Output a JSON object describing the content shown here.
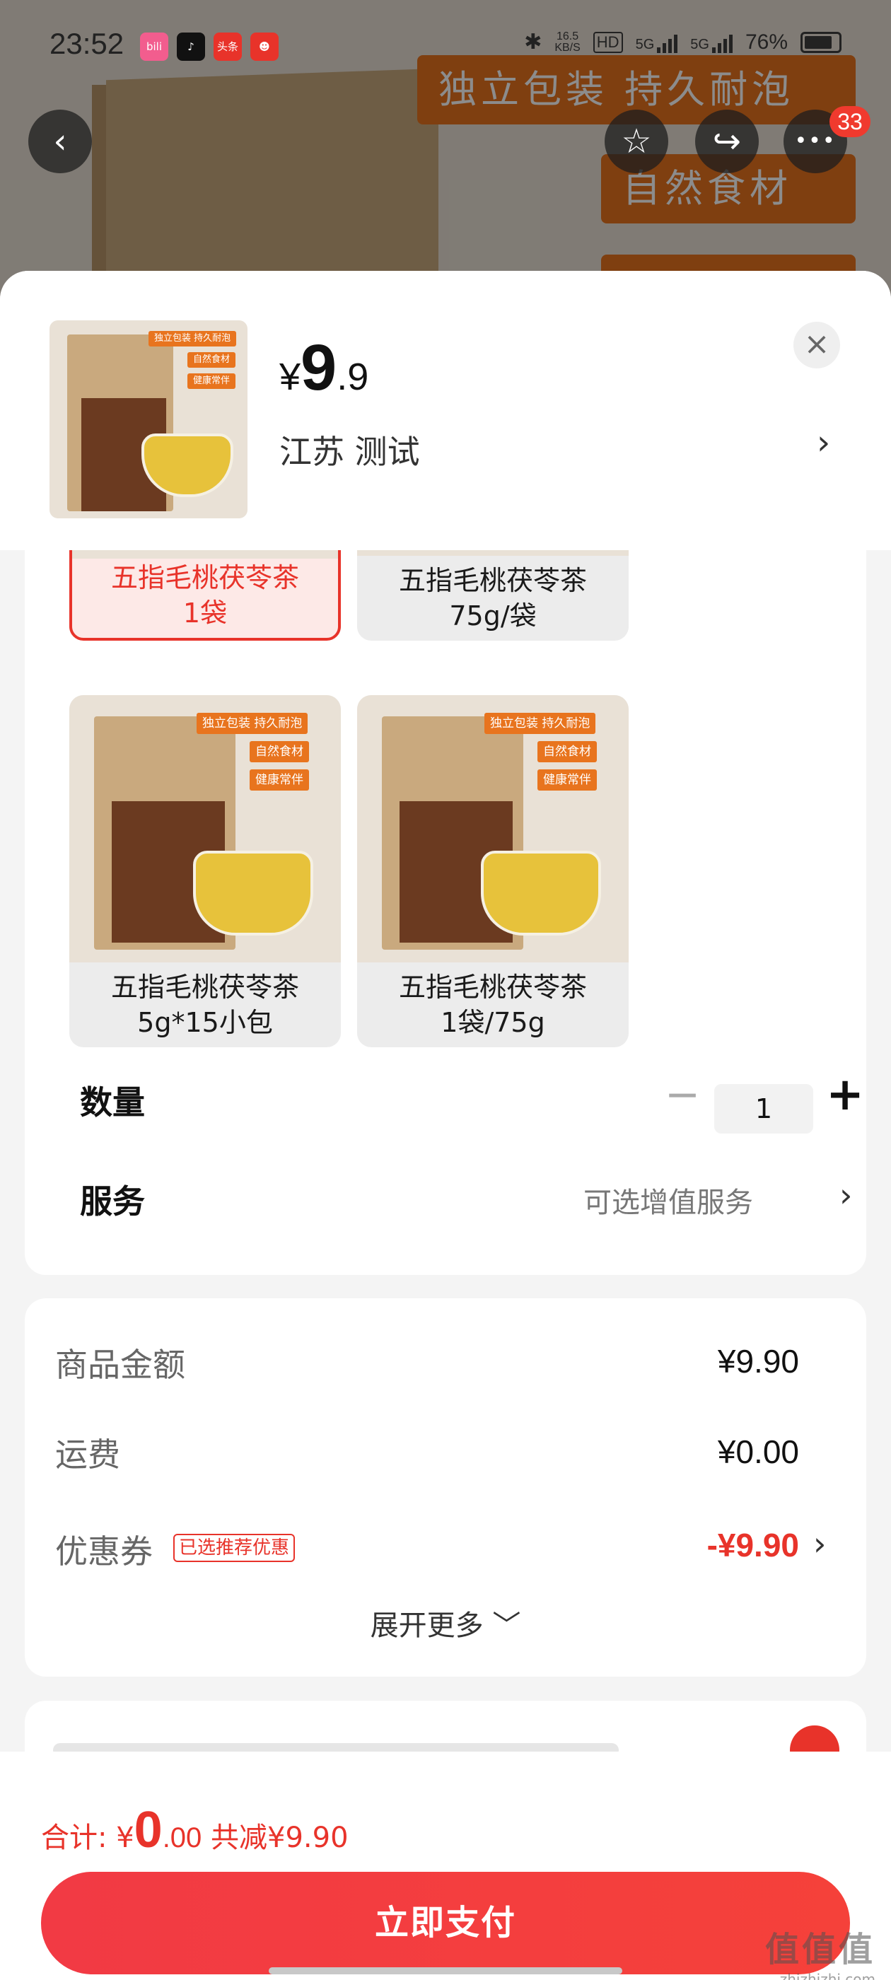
{
  "status_bar": {
    "time": "23:52",
    "app_icons": [
      {
        "name": "bilibili-icon",
        "text": "bili",
        "color": "#f25d8e"
      },
      {
        "name": "douyin-icon",
        "text": "♪",
        "color": "#111111"
      },
      {
        "name": "toutiao-icon",
        "text": "头条",
        "color": "#e8332a"
      },
      {
        "name": "notify-app-icon",
        "text": "☻",
        "color": "#e8332a"
      }
    ],
    "net_speed": "16.5",
    "net_unit": "KB/S",
    "hd": "HD",
    "signal1": "5G",
    "signal2": "5G",
    "battery": "76%"
  },
  "background": {
    "tag1": "独立包装 持久耐泡",
    "tag2": "自然食材"
  },
  "nav": {
    "back_icon": "‹",
    "favorite_icon": "☆",
    "share_icon": "↪",
    "more_icon": "•••",
    "badge_count": "33"
  },
  "sheet": {
    "price": {
      "currency": "¥",
      "integer": "9",
      "decimal": ".9"
    },
    "address": "江苏  测试",
    "address_arrow": "›",
    "close_icon": "×",
    "product_image_tags": [
      "独立包装 持久耐泡",
      "自然食材",
      "健康常伴"
    ]
  },
  "variants": [
    {
      "name_line1": "五指毛桃茯苓茶",
      "name_line2": "1袋",
      "selected": true
    },
    {
      "name_line1": "五指毛桃茯苓茶",
      "name_line2": "75g/袋",
      "selected": false
    },
    {
      "name_line1": "五指毛桃茯苓茶",
      "name_line2": "5g*15小包",
      "selected": false
    },
    {
      "name_line1": "五指毛桃茯苓茶",
      "name_line2": "1袋/75g",
      "selected": false
    }
  ],
  "quantity": {
    "label": "数量",
    "minus": "−",
    "value": "1",
    "plus": "+"
  },
  "service": {
    "label": "服务",
    "value": "可选增值服务",
    "arrow": "›"
  },
  "summary": {
    "goods_label": "商品金额",
    "goods_value": "¥9.90",
    "shipping_label": "运费",
    "shipping_value": "¥0.00",
    "coupon_label": "优惠券",
    "coupon_badge": "已选推荐优惠",
    "coupon_value": "-¥9.90",
    "coupon_arrow": "›",
    "expand_more": "展开更多 ﹀"
  },
  "bottom": {
    "total_label": "合计: ¥",
    "total_integer": "0",
    "total_decimal": ".00",
    "discount_text": " 共减¥9.90",
    "pay_button": "立即支付",
    "watermark": "值值值",
    "watermark_sub": "zhizhizhi.com"
  },
  "colors": {
    "accent": "#e8332a",
    "tag": "#e8741e"
  }
}
